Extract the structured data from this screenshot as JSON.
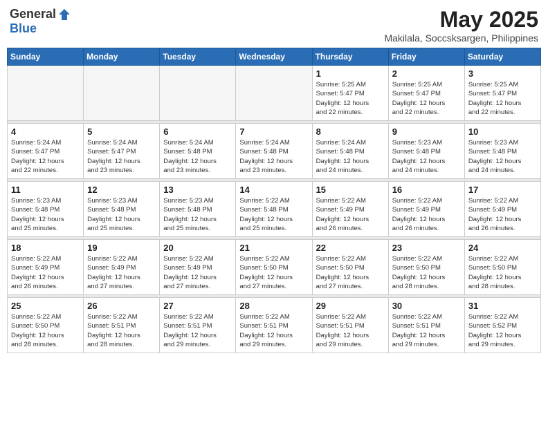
{
  "header": {
    "logo_general": "General",
    "logo_blue": "Blue",
    "month": "May 2025",
    "location": "Makilala, Soccsksargen, Philippines"
  },
  "weekdays": [
    "Sunday",
    "Monday",
    "Tuesday",
    "Wednesday",
    "Thursday",
    "Friday",
    "Saturday"
  ],
  "weeks": [
    [
      {
        "day": "",
        "info": ""
      },
      {
        "day": "",
        "info": ""
      },
      {
        "day": "",
        "info": ""
      },
      {
        "day": "",
        "info": ""
      },
      {
        "day": "1",
        "info": "Sunrise: 5:25 AM\nSunset: 5:47 PM\nDaylight: 12 hours\nand 22 minutes."
      },
      {
        "day": "2",
        "info": "Sunrise: 5:25 AM\nSunset: 5:47 PM\nDaylight: 12 hours\nand 22 minutes."
      },
      {
        "day": "3",
        "info": "Sunrise: 5:25 AM\nSunset: 5:47 PM\nDaylight: 12 hours\nand 22 minutes."
      }
    ],
    [
      {
        "day": "4",
        "info": "Sunrise: 5:24 AM\nSunset: 5:47 PM\nDaylight: 12 hours\nand 22 minutes."
      },
      {
        "day": "5",
        "info": "Sunrise: 5:24 AM\nSunset: 5:47 PM\nDaylight: 12 hours\nand 23 minutes."
      },
      {
        "day": "6",
        "info": "Sunrise: 5:24 AM\nSunset: 5:48 PM\nDaylight: 12 hours\nand 23 minutes."
      },
      {
        "day": "7",
        "info": "Sunrise: 5:24 AM\nSunset: 5:48 PM\nDaylight: 12 hours\nand 23 minutes."
      },
      {
        "day": "8",
        "info": "Sunrise: 5:24 AM\nSunset: 5:48 PM\nDaylight: 12 hours\nand 24 minutes."
      },
      {
        "day": "9",
        "info": "Sunrise: 5:23 AM\nSunset: 5:48 PM\nDaylight: 12 hours\nand 24 minutes."
      },
      {
        "day": "10",
        "info": "Sunrise: 5:23 AM\nSunset: 5:48 PM\nDaylight: 12 hours\nand 24 minutes."
      }
    ],
    [
      {
        "day": "11",
        "info": "Sunrise: 5:23 AM\nSunset: 5:48 PM\nDaylight: 12 hours\nand 25 minutes."
      },
      {
        "day": "12",
        "info": "Sunrise: 5:23 AM\nSunset: 5:48 PM\nDaylight: 12 hours\nand 25 minutes."
      },
      {
        "day": "13",
        "info": "Sunrise: 5:23 AM\nSunset: 5:48 PM\nDaylight: 12 hours\nand 25 minutes."
      },
      {
        "day": "14",
        "info": "Sunrise: 5:22 AM\nSunset: 5:48 PM\nDaylight: 12 hours\nand 25 minutes."
      },
      {
        "day": "15",
        "info": "Sunrise: 5:22 AM\nSunset: 5:49 PM\nDaylight: 12 hours\nand 26 minutes."
      },
      {
        "day": "16",
        "info": "Sunrise: 5:22 AM\nSunset: 5:49 PM\nDaylight: 12 hours\nand 26 minutes."
      },
      {
        "day": "17",
        "info": "Sunrise: 5:22 AM\nSunset: 5:49 PM\nDaylight: 12 hours\nand 26 minutes."
      }
    ],
    [
      {
        "day": "18",
        "info": "Sunrise: 5:22 AM\nSunset: 5:49 PM\nDaylight: 12 hours\nand 26 minutes."
      },
      {
        "day": "19",
        "info": "Sunrise: 5:22 AM\nSunset: 5:49 PM\nDaylight: 12 hours\nand 27 minutes."
      },
      {
        "day": "20",
        "info": "Sunrise: 5:22 AM\nSunset: 5:49 PM\nDaylight: 12 hours\nand 27 minutes."
      },
      {
        "day": "21",
        "info": "Sunrise: 5:22 AM\nSunset: 5:50 PM\nDaylight: 12 hours\nand 27 minutes."
      },
      {
        "day": "22",
        "info": "Sunrise: 5:22 AM\nSunset: 5:50 PM\nDaylight: 12 hours\nand 27 minutes."
      },
      {
        "day": "23",
        "info": "Sunrise: 5:22 AM\nSunset: 5:50 PM\nDaylight: 12 hours\nand 28 minutes."
      },
      {
        "day": "24",
        "info": "Sunrise: 5:22 AM\nSunset: 5:50 PM\nDaylight: 12 hours\nand 28 minutes."
      }
    ],
    [
      {
        "day": "25",
        "info": "Sunrise: 5:22 AM\nSunset: 5:50 PM\nDaylight: 12 hours\nand 28 minutes."
      },
      {
        "day": "26",
        "info": "Sunrise: 5:22 AM\nSunset: 5:51 PM\nDaylight: 12 hours\nand 28 minutes."
      },
      {
        "day": "27",
        "info": "Sunrise: 5:22 AM\nSunset: 5:51 PM\nDaylight: 12 hours\nand 29 minutes."
      },
      {
        "day": "28",
        "info": "Sunrise: 5:22 AM\nSunset: 5:51 PM\nDaylight: 12 hours\nand 29 minutes."
      },
      {
        "day": "29",
        "info": "Sunrise: 5:22 AM\nSunset: 5:51 PM\nDaylight: 12 hours\nand 29 minutes."
      },
      {
        "day": "30",
        "info": "Sunrise: 5:22 AM\nSunset: 5:51 PM\nDaylight: 12 hours\nand 29 minutes."
      },
      {
        "day": "31",
        "info": "Sunrise: 5:22 AM\nSunset: 5:52 PM\nDaylight: 12 hours\nand 29 minutes."
      }
    ]
  ]
}
